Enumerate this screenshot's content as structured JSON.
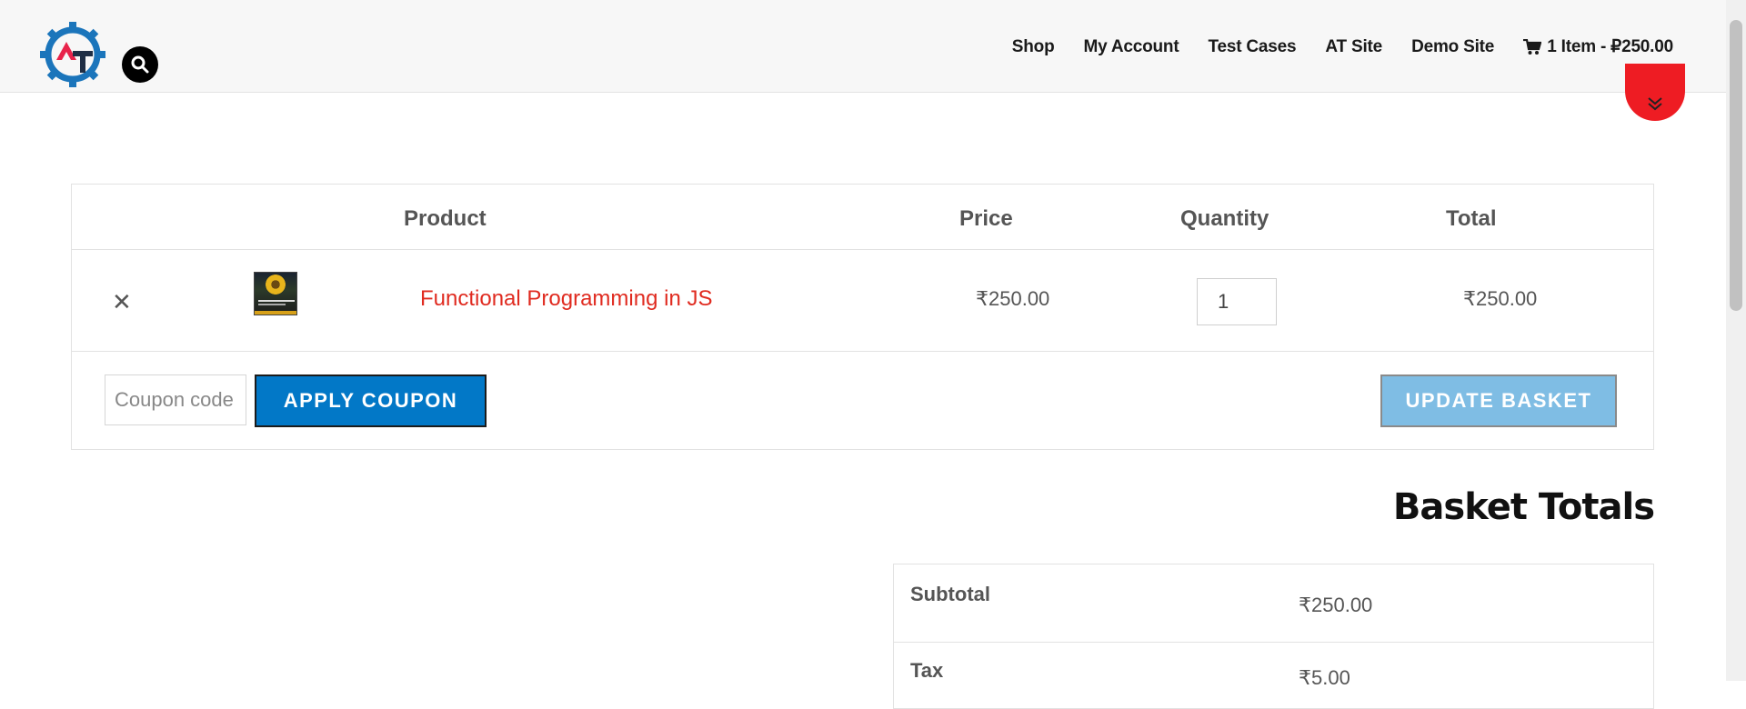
{
  "header": {
    "nav": [
      {
        "label": "Shop"
      },
      {
        "label": "My Account"
      },
      {
        "label": "Test Cases"
      },
      {
        "label": "AT Site"
      },
      {
        "label": "Demo Site"
      }
    ],
    "cart_label": "1 Item - ₽250.00"
  },
  "cart": {
    "headers": {
      "product": "Product",
      "price": "Price",
      "quantity": "Quantity",
      "total": "Total"
    },
    "items": [
      {
        "name": "Functional Programming in JS",
        "price": "₹250.00",
        "quantity": "1",
        "total": "₹250.00"
      }
    ],
    "coupon_placeholder": "Coupon code",
    "apply_coupon_label": "APPLY COUPON",
    "update_basket_label": "UPDATE BASKET"
  },
  "totals": {
    "title": "Basket Totals",
    "rows": [
      {
        "label": "Subtotal",
        "value": "₹250.00"
      },
      {
        "label": "Tax",
        "value": "₹5.00"
      }
    ]
  },
  "colors": {
    "accent_red": "#ee1c23",
    "product_link": "#e02b20",
    "apply_button": "#0278c7",
    "update_button": "#7fbde4"
  }
}
